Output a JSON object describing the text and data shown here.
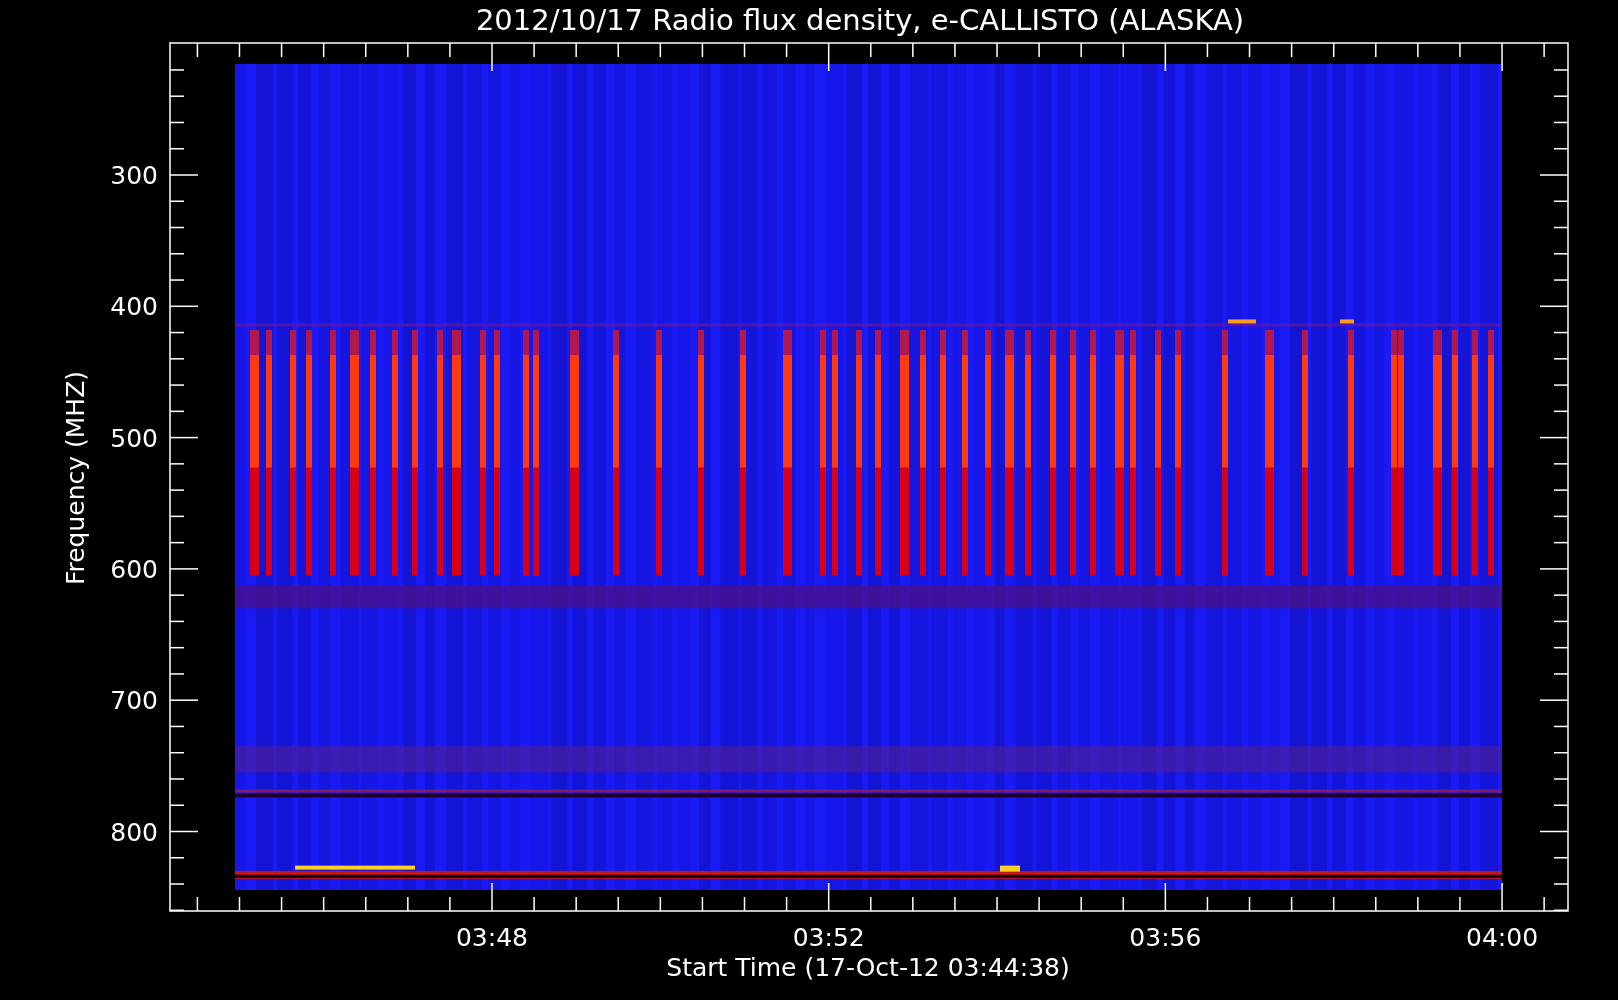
{
  "title": "2012/10/17  Radio flux density, e-CALLISTO (ALASKA)",
  "y_axis": {
    "label": "Frequency (MHZ)",
    "ticks": [
      "300",
      "400",
      "500",
      "600",
      "700",
      "800"
    ]
  },
  "x_axis": {
    "label": "Start Time (17-Oct-12 03:44:38)",
    "ticks": [
      "03:48",
      "03:52",
      "03:56",
      "04:00"
    ]
  }
}
